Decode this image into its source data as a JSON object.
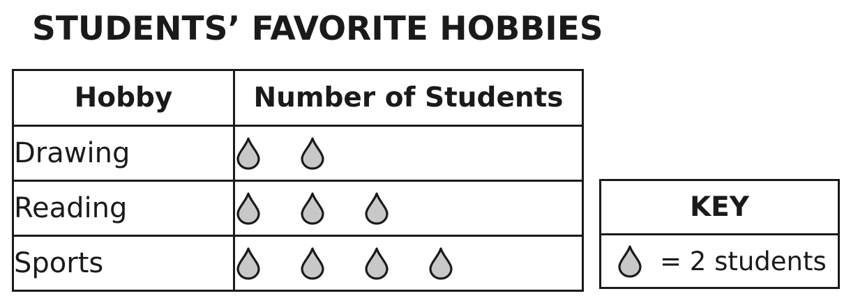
{
  "chart_data": {
    "type": "table",
    "title": "STUDENTS’ FAVORITE HOBBIES",
    "columns": [
      "Hobby",
      "Number of Students"
    ],
    "rows": [
      {
        "hobby": "Drawing",
        "symbols": 2
      },
      {
        "hobby": "Reading",
        "symbols": 3
      },
      {
        "hobby": "Sports",
        "symbols": 4
      }
    ],
    "key": {
      "title": "KEY",
      "label": "= 2 students",
      "students_per_symbol": 2
    },
    "symbol_icon": "drop-icon",
    "colors": {
      "symbol_fill": "#c8c8c8",
      "stroke": "#1a1a1a"
    }
  }
}
